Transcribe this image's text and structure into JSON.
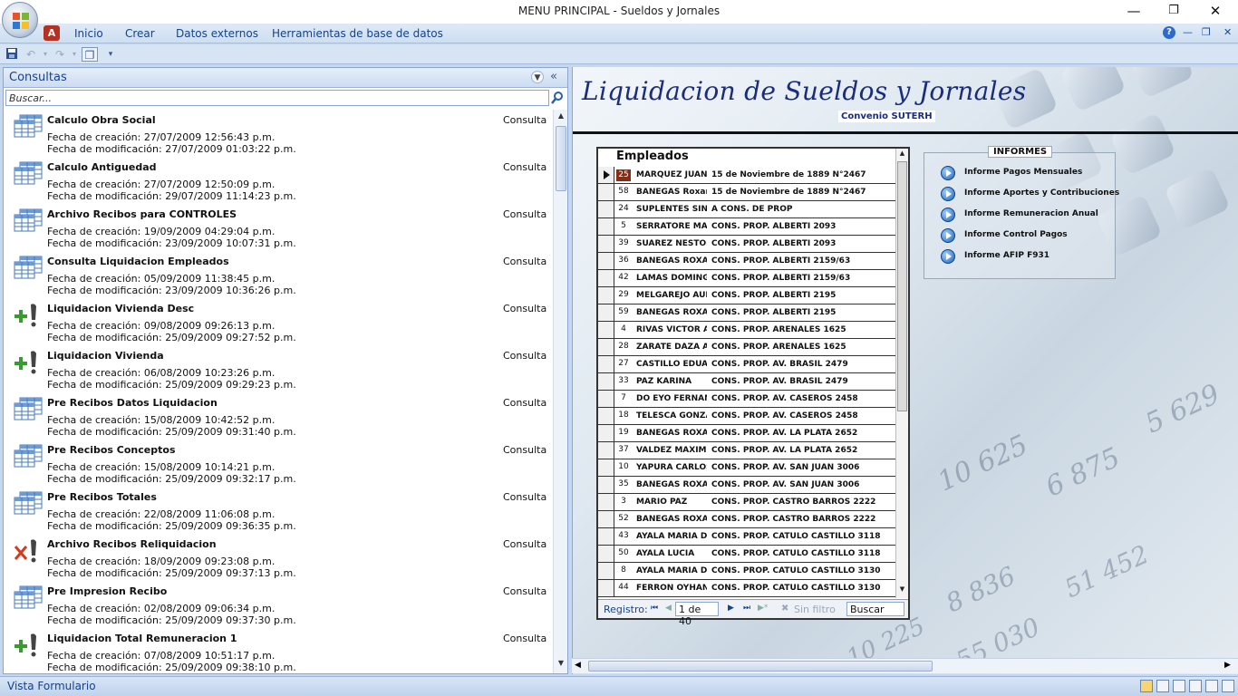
{
  "window": {
    "title": "MENU PRINCIPAL  -  Sueldos y Jornales",
    "minimize": "—",
    "maximize": "❐",
    "close": "✕"
  },
  "ribbon": {
    "tabs": [
      "Inicio",
      "Crear",
      "Datos externos",
      "Herramientas de base de datos"
    ],
    "help": "?"
  },
  "nav_pane": {
    "title": "Consultas",
    "search_placeholder": "Buscar...",
    "items": [
      {
        "name": "Calculo Obra Social",
        "type": "Consulta",
        "created": "Fecha de creación: 27/07/2009 12:56:43 p.m.",
        "modified": "Fecha de modificación: 27/07/2009 01:03:22 p.m.",
        "icon": "select-query-icon"
      },
      {
        "name": "Calculo Antiguedad",
        "type": "Consulta",
        "created": "Fecha de creación: 27/07/2009 12:50:09 p.m.",
        "modified": "Fecha de modificación: 29/07/2009 11:14:23 p.m.",
        "icon": "select-query-icon"
      },
      {
        "name": "Archivo Recibos para CONTROLES",
        "type": "Consulta",
        "created": "Fecha de creación: 19/09/2009 04:29:04 p.m.",
        "modified": "Fecha de modificación: 23/09/2009 10:07:31 p.m.",
        "icon": "select-query-icon"
      },
      {
        "name": "Consulta Liquidacion Empleados",
        "type": "Consulta",
        "created": "Fecha de creación: 05/09/2009 11:38:45 p.m.",
        "modified": "Fecha de modificación: 23/09/2009 10:36:26 p.m.",
        "icon": "select-query-icon"
      },
      {
        "name": "Liquidacion Vivienda Desc",
        "type": "Consulta",
        "created": "Fecha de creación: 09/08/2009 09:26:13 p.m.",
        "modified": "Fecha de modificación: 25/09/2009 09:27:52 p.m.",
        "icon": "append-query-icon"
      },
      {
        "name": "Liquidacion Vivienda",
        "type": "Consulta",
        "created": "Fecha de creación: 06/08/2009 10:23:26 p.m.",
        "modified": "Fecha de modificación: 25/09/2009 09:29:23 p.m.",
        "icon": "append-query-icon"
      },
      {
        "name": "Pre Recibos Datos Liquidacion",
        "type": "Consulta",
        "created": "Fecha de creación: 15/08/2009 10:42:52 p.m.",
        "modified": "Fecha de modificación: 25/09/2009 09:31:40 p.m.",
        "icon": "select-query-icon"
      },
      {
        "name": "Pre Recibos Conceptos",
        "type": "Consulta",
        "created": "Fecha de creación: 15/08/2009 10:14:21 p.m.",
        "modified": "Fecha de modificación: 25/09/2009 09:32:17 p.m.",
        "icon": "select-query-icon"
      },
      {
        "name": "Pre Recibos Totales",
        "type": "Consulta",
        "created": "Fecha de creación: 22/08/2009 11:06:08 p.m.",
        "modified": "Fecha de modificación: 25/09/2009 09:36:35 p.m.",
        "icon": "select-query-icon"
      },
      {
        "name": "Archivo Recibos Reliquidacion",
        "type": "Consulta",
        "created": "Fecha de creación: 18/09/2009 09:23:08 p.m.",
        "modified": "Fecha de modificación: 25/09/2009 09:37:13 p.m.",
        "icon": "delete-query-icon"
      },
      {
        "name": "Pre Impresion Recibo",
        "type": "Consulta",
        "created": "Fecha de creación: 02/08/2009 09:06:34 p.m.",
        "modified": "Fecha de modificación: 25/09/2009 09:37:30 p.m.",
        "icon": "select-query-icon"
      },
      {
        "name": "Liquidacion Total Remuneracion 1",
        "type": "Consulta",
        "created": "Fecha de creación: 07/08/2009 10:51:17 p.m.",
        "modified": "Fecha de modificación: 25/09/2009 09:38:10 p.m.",
        "icon": "append-query-icon"
      }
    ]
  },
  "form": {
    "title": "Liquidacion de Sueldos y Jornales",
    "subtitle": "Convenio SUTERH",
    "empleados": {
      "header": "Empleados",
      "rows": [
        {
          "id": "25",
          "name": "MARQUEZ JUANA",
          "address": "15 de Noviembre de 1889 N°2467"
        },
        {
          "id": "58",
          "name": "BANEGAS Roxana",
          "address": "15 de Noviembre de 1889 N°2467"
        },
        {
          "id": "24",
          "name": "SUPLENTES SIN",
          "address": "A CONS. DE PROP"
        },
        {
          "id": "5",
          "name": "SERRATORE MAR",
          "address": "CONS. PROP. ALBERTI 2093"
        },
        {
          "id": "39",
          "name": "SUAREZ NESTOR",
          "address": "CONS. PROP. ALBERTI 2093"
        },
        {
          "id": "36",
          "name": "BANEGAS ROXAN",
          "address": "CONS. PROP. ALBERTI 2159/63"
        },
        {
          "id": "42",
          "name": "LAMAS DOMINGO",
          "address": "CONS. PROP. ALBERTI 2159/63"
        },
        {
          "id": "29",
          "name": "MELGAREJO AUR",
          "address": "CONS. PROP. ALBERTI 2195"
        },
        {
          "id": "59",
          "name": "BANEGAS ROXAN",
          "address": "CONS. PROP. ALBERTI 2195"
        },
        {
          "id": "4",
          "name": "RIVAS VICTOR AC",
          "address": "CONS. PROP. ARENALES 1625"
        },
        {
          "id": "28",
          "name": "ZARATE DAZA ALI",
          "address": "CONS. PROP. ARENALES 1625"
        },
        {
          "id": "27",
          "name": "CASTILLO EDUAR",
          "address": "CONS. PROP. AV. BRASIL 2479"
        },
        {
          "id": "33",
          "name": "PAZ KARINA",
          "address": "CONS. PROP. AV. BRASIL 2479"
        },
        {
          "id": "7",
          "name": "DO EYO FERNAN",
          "address": "CONS. PROP. AV. CASEROS 2458"
        },
        {
          "id": "18",
          "name": "TELESCA GONZA",
          "address": "CONS. PROP. AV. CASEROS 2458"
        },
        {
          "id": "19",
          "name": "BANEGAS ROXAN",
          "address": "CONS. PROP. AV. LA PLATA 2652"
        },
        {
          "id": "37",
          "name": "VALDEZ MAXIMO",
          "address": "CONS. PROP. AV. LA PLATA 2652"
        },
        {
          "id": "10",
          "name": "YAPURA CARLOS",
          "address": "CONS. PROP. AV. SAN JUAN 3006"
        },
        {
          "id": "35",
          "name": "BANEGAS ROXAN",
          "address": "CONS. PROP. AV. SAN JUAN 3006"
        },
        {
          "id": "3",
          "name": "MARIO PAZ",
          "address": "CONS. PROP. CASTRO BARROS 2222"
        },
        {
          "id": "52",
          "name": "BANEGAS ROXAN",
          "address": "CONS. PROP. CASTRO BARROS 2222"
        },
        {
          "id": "43",
          "name": "AYALA MARIA DEL",
          "address": "CONS. PROP. CATULO CASTILLO 3118"
        },
        {
          "id": "50",
          "name": "AYALA LUCIA",
          "address": "CONS. PROP. CATULO CASTILLO 3118"
        },
        {
          "id": "8",
          "name": "AYALA MARIA DEL",
          "address": "CONS. PROP. CATULO CASTILLO 3130"
        },
        {
          "id": "44",
          "name": "FERRON OYHAN/",
          "address": "CONS. PROP. CATULO CASTILLO 3130"
        }
      ],
      "nav": {
        "label": "Registro:",
        "record": "1 de 40",
        "filter": "Sin filtro",
        "search": "Buscar"
      }
    },
    "informes": {
      "caption": "INFORMES",
      "buttons": [
        "Informe Pagos Mensuales",
        "Informe Aportes y Contribuciones",
        "Informe Remuneracion Anual",
        "Informe Control Pagos",
        "Informe AFIP F931"
      ]
    }
  },
  "status": {
    "text": "Vista Formulario"
  },
  "colors": {
    "ribbon_text": "#15428b",
    "title_blue": "#1b2d7a",
    "selected_id_bg": "#8a2b12"
  }
}
